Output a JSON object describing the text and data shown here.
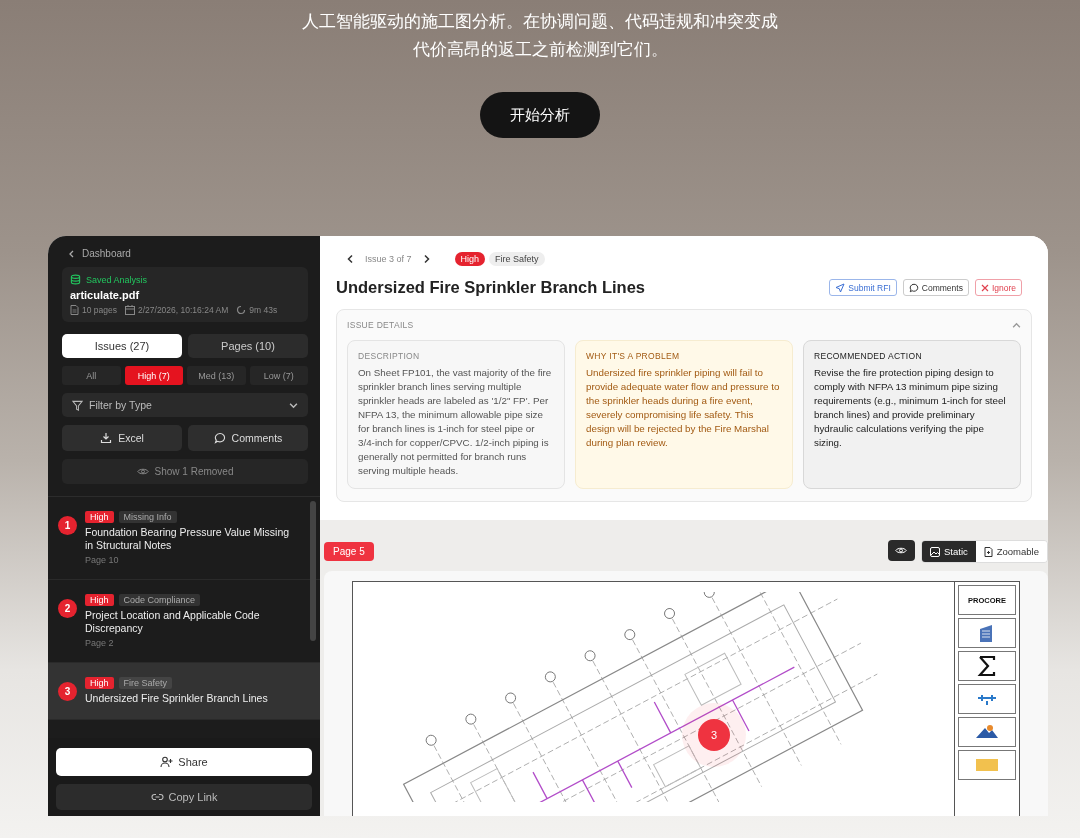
{
  "hero": {
    "tagline": "人工智能驱动的施工图分析。在协调问题、代码违规和冲突变成代价高昂的返工之前检测到它们。",
    "button": "开始分析"
  },
  "sidebar": {
    "back": "Dashboard",
    "saved_label": "Saved Analysis",
    "file": "articulate.pdf",
    "meta": [
      {
        "kind": "pages",
        "text": "10 pages"
      },
      {
        "kind": "date",
        "text": "2/27/2026, 10:16:24 AM"
      },
      {
        "kind": "duration",
        "text": "9m 43s"
      }
    ],
    "tabs": [
      {
        "label": "Issues (27)",
        "selected": true
      },
      {
        "label": "Pages (10)",
        "selected": false
      }
    ],
    "severity_filters": [
      {
        "label": "All",
        "selected": false
      },
      {
        "label": "High (7)",
        "selected": true
      },
      {
        "label": "Med (13)",
        "selected": false
      },
      {
        "label": "Low (7)",
        "selected": false
      }
    ],
    "type_filter": {
      "placeholder": "Filter by Type"
    },
    "actions": [
      {
        "kind": "excel",
        "label": "Excel"
      },
      {
        "kind": "comments",
        "label": "Comments"
      }
    ],
    "show_removed": "Show 1 Removed",
    "issues": [
      {
        "number": "1",
        "severity": "High",
        "category": "Missing Info",
        "title": "Foundation Bearing Pressure Value Missing in Structural Notes",
        "page": "Page 10",
        "selected": false
      },
      {
        "number": "2",
        "severity": "High",
        "category": "Code Compliance",
        "title": "Project Location and Applicable Code Discrepancy",
        "page": "Page 2",
        "selected": false
      },
      {
        "number": "3",
        "severity": "High",
        "category": "Fire Safety",
        "title": "Undersized Fire Sprinkler Branch Lines",
        "selected": true
      }
    ],
    "share": "Share",
    "copy_link": "Copy Link"
  },
  "issue": {
    "position": "Issue 3 of 7",
    "severity": "High",
    "category": "Fire Safety",
    "title": "Undersized Fire Sprinkler Branch Lines",
    "actions": [
      {
        "kind": "rfi",
        "label": "Submit RFI"
      },
      {
        "kind": "comments",
        "label": "Comments"
      },
      {
        "kind": "ignore",
        "label": "Ignore"
      }
    ],
    "details": {
      "heading": "ISSUE DETAILS",
      "expanded": true,
      "cards": [
        {
          "kind": "description",
          "heading": "DESCRIPTION",
          "text": "On Sheet FP101, the vast majority of the fire sprinkler branch lines serving multiple sprinkler heads are labeled as '1/2\" FP'. Per NFPA 13, the minimum allowable pipe size for branch lines is 1-inch for steel pipe or 3/4-inch for copper/CPVC. 1/2-inch piping is generally not permitted for branch runs serving multiple heads."
        },
        {
          "kind": "problem",
          "heading": "WHY IT'S A PROBLEM",
          "text": "Undersized fire sprinkler piping will fail to provide adequate water flow and pressure to the sprinkler heads during a fire event, severely compromising life safety. This design will be rejected by the Fire Marshal during plan review."
        },
        {
          "kind": "action",
          "heading": "RECOMMENDED ACTION",
          "text": "Revise the fire protection piping design to comply with NFPA 13 minimum pipe sizing requirements (e.g., minimum 1-inch for steel branch lines) and provide preliminary hydraulic calculations verifying the pipe sizing."
        }
      ]
    }
  },
  "viewer": {
    "page": "Page 5",
    "modes": [
      {
        "kind": "static",
        "label": "Static",
        "selected": true
      },
      {
        "kind": "zoomable",
        "label": "Zoomable",
        "selected": false
      }
    ],
    "marker": "3",
    "title_block": "PROCORE"
  }
}
